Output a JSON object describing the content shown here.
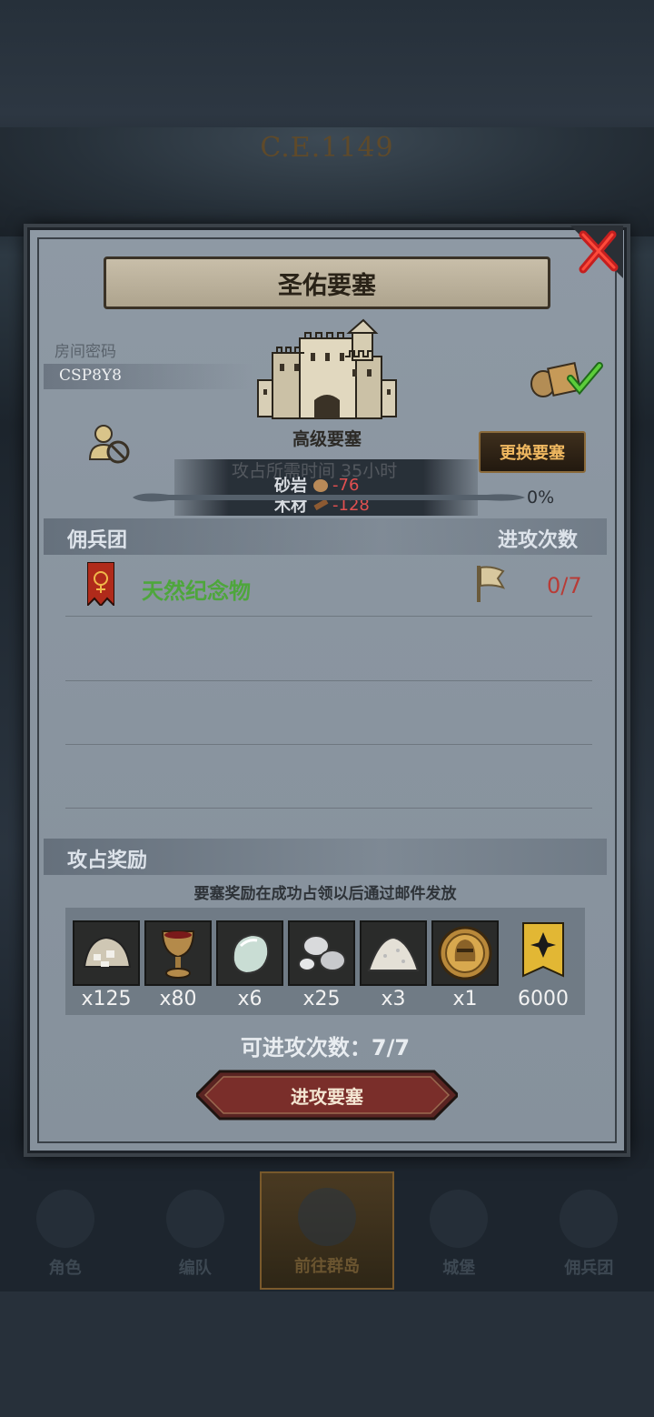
{
  "background": {
    "era": "C.E.1149",
    "nav": [
      {
        "label": "角色",
        "active": false
      },
      {
        "label": "编队",
        "active": false
      },
      {
        "label": "前往群岛",
        "active": true
      },
      {
        "label": "城堡",
        "active": false
      },
      {
        "label": "佣兵团",
        "active": false
      }
    ]
  },
  "dialog": {
    "title": "圣佑要塞",
    "room_label": "房间密码",
    "room_code": "CSP8Y8",
    "fortress_level": "高级要塞",
    "change_button": "更换要塞",
    "costs": [
      {
        "name": "砂岩",
        "value": "-76",
        "icon": "stone-icon"
      },
      {
        "name": "木材",
        "value": "-128",
        "icon": "wood-icon"
      }
    ],
    "ghost_text": "攻占所需时间 35小时",
    "progress": {
      "percent_label": "0%",
      "value": 0
    },
    "mercenary_section": {
      "title": "佣兵团",
      "right": "进攻次数"
    },
    "mercenaries": [
      {
        "name": "天然纪念物",
        "attacks": "0/7"
      }
    ],
    "reward_section": {
      "title": "攻占奖励",
      "note": "要塞奖励在成功占领以后通过邮件发放"
    },
    "rewards": [
      {
        "item": "stone-rubble-icon",
        "qty": "x125"
      },
      {
        "item": "goblet-icon",
        "qty": "x80"
      },
      {
        "item": "gem-icon",
        "qty": "x6"
      },
      {
        "item": "silver-ore-icon",
        "qty": "x25"
      },
      {
        "item": "salt-pile-icon",
        "qty": "x3"
      },
      {
        "item": "knight-coin-icon",
        "qty": "x1"
      },
      {
        "item": "guild-badge-icon",
        "qty": "6000"
      }
    ],
    "attack_count": "可进攻次数：7/7",
    "attack_button": "进攻要塞",
    "colors": {
      "accent_gold": "#f0b860",
      "green_name": "#4ea63c",
      "red_count": "#b83b36",
      "cost_red": "#e25050"
    }
  }
}
